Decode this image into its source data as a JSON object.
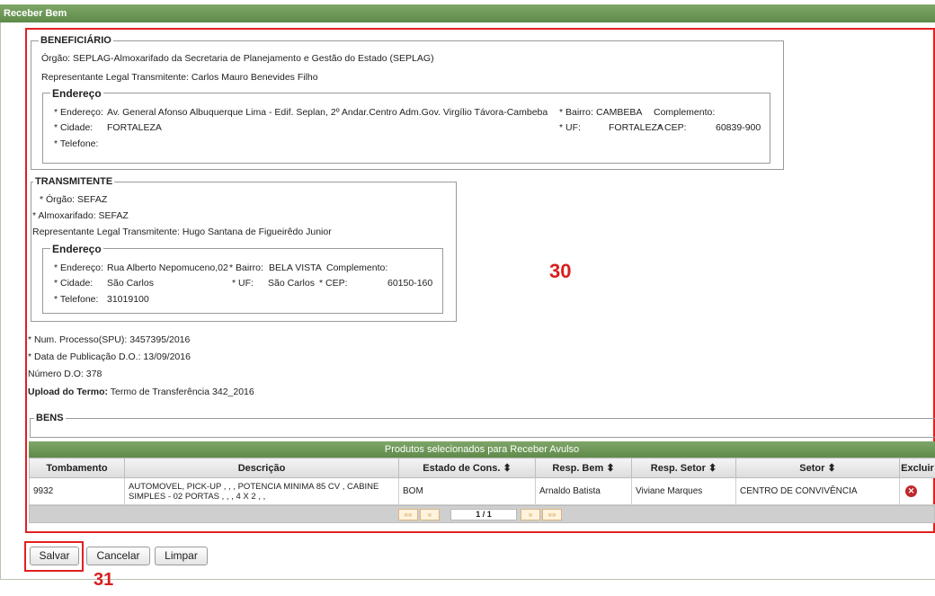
{
  "window": {
    "title": "Receber Bem"
  },
  "annotations": {
    "box30_label": "30",
    "box31_label": "31"
  },
  "beneficiario": {
    "legend": "BENEFICIÁRIO",
    "orgao": "Órgão: SEPLAG-Almoxarifado da Secretaria de Planejamento e Gestão do Estado (SEPLAG)",
    "representante": "Representante Legal Transmitente: Carlos Mauro Benevides Filho",
    "endereco": {
      "legend": "Endereço",
      "endereco_label": "* Endereço:",
      "endereco_value": "Av. General Afonso Albuquerque Lima - Edif. Seplan, 2º Andar.Centro Adm.Gov. Virgílio Távora-Cambeba",
      "bairro_label": "* Bairro:",
      "bairro_value": "CAMBEBA",
      "complemento_label": "Complemento:",
      "cidade_label": "* Cidade:",
      "cidade_value": "FORTALEZA",
      "uf_label": "* UF:",
      "uf_value": "FORTALEZA",
      "cep_label": "* CEP:",
      "cep_value": "60839-900",
      "telefone_label": "* Telefone:",
      "telefone_value": ""
    }
  },
  "transmitente": {
    "legend": "TRANSMITENTE",
    "orgao": "* Órgão: SEFAZ",
    "almoxarifado": "* Almoxarifado: SEFAZ",
    "representante": "Representante Legal Transmitente: Hugo Santana de Figueirêdo Junior",
    "endereco": {
      "legend": "Endereço",
      "endereco_label": "* Endereço:",
      "endereco_value": "Rua Alberto Nepomuceno,02",
      "bairro_label": "* Bairro:",
      "bairro_value": "BELA VISTA",
      "complemento_label": "Complemento:",
      "cidade_label": "* Cidade:",
      "cidade_value": "São Carlos",
      "uf_label": "* UF:",
      "uf_value": "São Carlos",
      "cep_label": "* CEP:",
      "cep_value": "60150-160",
      "telefone_label": "* Telefone:",
      "telefone_value": "31019100"
    }
  },
  "info": {
    "num_processo": "* Num. Processo(SPU): 3457395/2016",
    "data_publicacao": "* Data de Publicação D.O.: 13/09/2016",
    "numero_do": "Número D.O: 378",
    "upload_label": "Upload do Termo:",
    "upload_value": "Termo de Transferência 342_2016"
  },
  "bens": {
    "legend": "BENS"
  },
  "grid": {
    "title": "Produtos selecionados para Receber Avulso",
    "columns": [
      "Tombamento",
      "Descrição",
      "Estado de Cons. ⬍",
      "Resp. Bem ⬍",
      "Resp. Setor ⬍",
      "Setor ⬍",
      "Excluir"
    ],
    "rows": [
      {
        "tombamento": "9932",
        "descricao": "AUTOMOVEL, PICK-UP , , , POTENCIA MINIMA 85 CV , CABINE SIMPLES - 02 PORTAS , , , 4 X 2 , ,",
        "estado": "BOM",
        "resp_bem": "Arnaldo Batista",
        "resp_setor": "Viviane Marques",
        "setor": "CENTRO DE CONVIVÊNCIA",
        "excluir_icon": "delete-icon"
      }
    ],
    "pager": {
      "first": "««",
      "prev": "«",
      "current": "1 / 1",
      "next": "»",
      "last": "»»"
    }
  },
  "buttons": {
    "salvar": "Salvar",
    "cancelar": "Cancelar",
    "limpar": "Limpar"
  }
}
